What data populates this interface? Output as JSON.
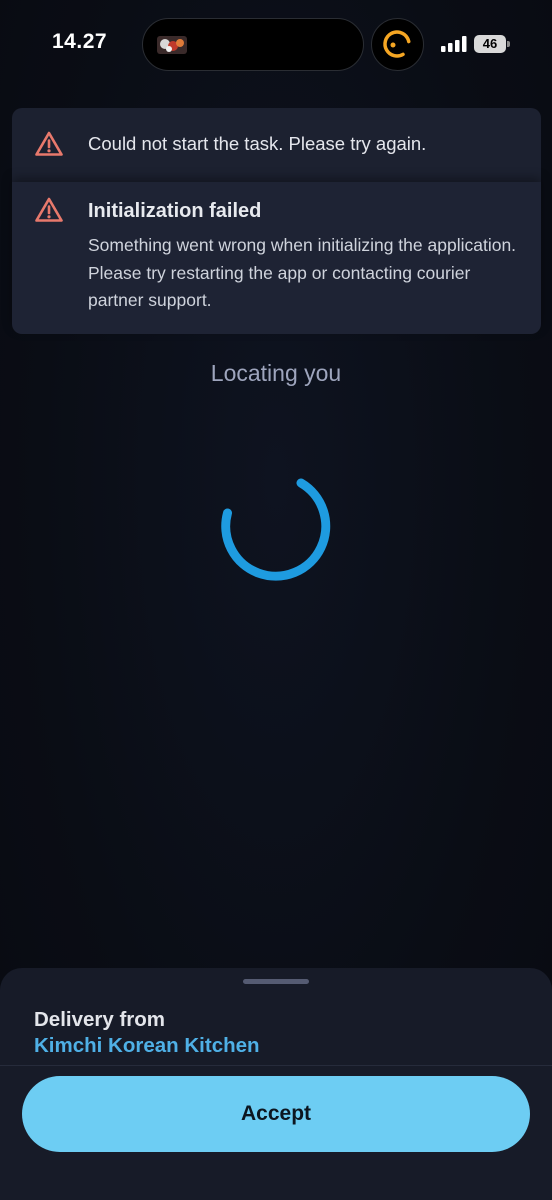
{
  "status_bar": {
    "time": "14.27",
    "battery_level": "46"
  },
  "alerts": [
    {
      "icon": "warning-icon",
      "text": "Could not start the task. Please try again."
    },
    {
      "icon": "warning-icon",
      "title": "Initialization failed",
      "body": "Something went wrong when initializing the application. Please try restarting the app or contacting courier partner support."
    }
  ],
  "locating": {
    "text": "Locating you"
  },
  "sheet": {
    "delivery_label": "Delivery from",
    "restaurant_name": "Kimchi Korean Kitchen",
    "accept_label": "Accept"
  },
  "colors": {
    "background": "#0a0d15",
    "card": "#1c2130",
    "warning": "#e8796c",
    "spinner": "#1e9be0",
    "accent_text": "#4fb0e6",
    "accept_button": "#6dcdf3",
    "activity_ring": "#f5a623"
  }
}
